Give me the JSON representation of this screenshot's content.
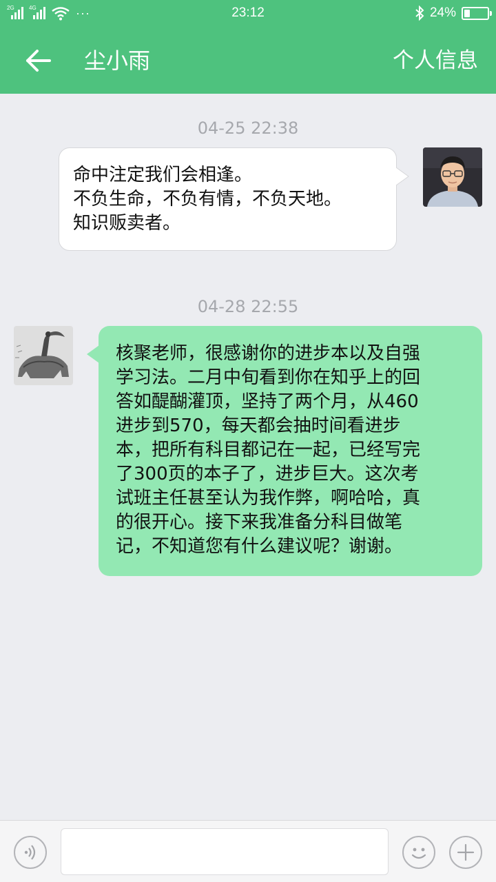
{
  "status_bar": {
    "network_1": "2G",
    "network_2": "4G",
    "more": "···",
    "time": "23:12",
    "battery_text": "24%",
    "battery_level": 0.24,
    "icons": [
      "signal-icon",
      "signal-icon",
      "wifi-icon",
      "bluetooth-icon",
      "battery-icon"
    ]
  },
  "header": {
    "back_icon": "arrow-left-icon",
    "title": "尘小雨",
    "profile_link": "个人信息",
    "color": "#4ec27e"
  },
  "messages": [
    {
      "timestamp": "04-25 22:38",
      "side": "incoming",
      "lines": [
        "命中注定我们会相逢。",
        "不负生命，不负有情，不负天地。",
        "知识贩卖者。"
      ]
    },
    {
      "timestamp": "04-28 22:55",
      "side": "outgoing",
      "lines": [
        "核聚老师，很感谢你的进步本以及自强",
        "学习法。二月中旬看到你在知乎上的回",
        "答如醍醐灌顶，坚持了两个月，从460",
        "进步到570，每天都会抽时间看进步",
        "本，把所有科目都记在一起，已经写完",
        "了300页的本子了，进步巨大。这次考",
        "试班主任甚至认为我作弊，啊哈哈，真",
        "的很开心。接下来我准备分科目做笔",
        "记，不知道您有什么建议呢？谢谢。"
      ]
    }
  ],
  "input_bar": {
    "voice_icon": "voice-icon",
    "placeholder": "",
    "emoji_icon": "emoji-icon",
    "plus_icon": "plus-icon"
  },
  "colors": {
    "accent": "#4ec27e",
    "outgoing_bubble": "#93e8b3",
    "incoming_bubble": "#ffffff",
    "background": "#ecedf1"
  }
}
